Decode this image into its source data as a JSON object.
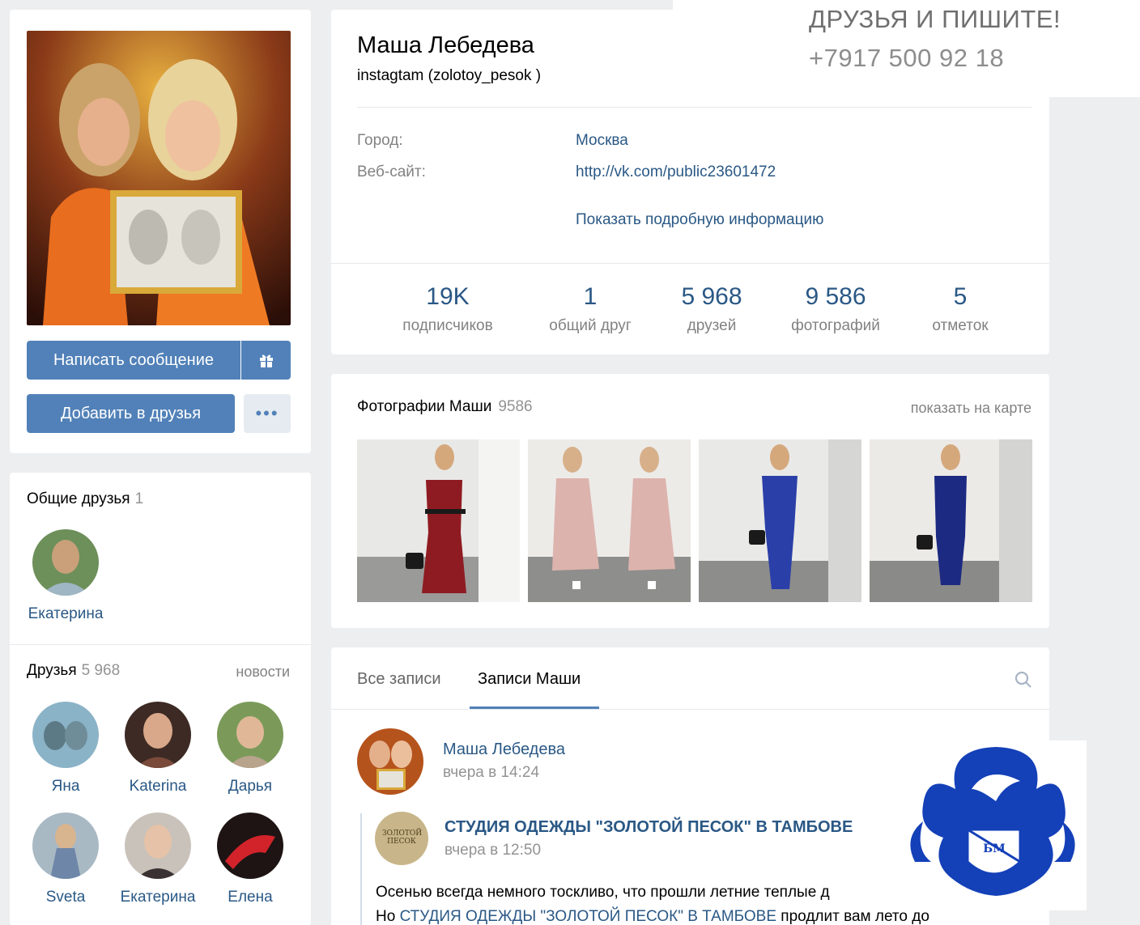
{
  "profile": {
    "name": "Маша Лебедева",
    "status": "instagtam (zolotoy_pesok )",
    "buttons": {
      "message": "Написать сообщение",
      "add_friend": "Добавить в друзья",
      "more": "•••"
    },
    "info": [
      {
        "label": "Город:",
        "value": "Москва"
      },
      {
        "label": "Веб-сайт:",
        "value": "http://vk.com/public23601472"
      }
    ],
    "show_more": "Показать подробную информацию",
    "stats": [
      {
        "num": "19K",
        "label": "подписчиков"
      },
      {
        "num": "1",
        "label": "общий друг"
      },
      {
        "num": "5 968",
        "label": "друзей"
      },
      {
        "num": "9 586",
        "label": "фотографий"
      },
      {
        "num": "5",
        "label": "отметок"
      }
    ]
  },
  "mutual": {
    "title": "Общие друзья",
    "count": "1",
    "friends": [
      {
        "name": "Екатерина"
      }
    ]
  },
  "friends": {
    "title": "Друзья",
    "count": "5 968",
    "news_link": "новости",
    "items": [
      {
        "name": "Яна"
      },
      {
        "name": "Katerina"
      },
      {
        "name": "Дарья"
      },
      {
        "name": "Sveta"
      },
      {
        "name": "Екатерина"
      },
      {
        "name": "Елена"
      }
    ]
  },
  "photos": {
    "title": "Фотографии Маши",
    "count": "9586",
    "map_link": "показать на карте"
  },
  "wall": {
    "tabs": [
      {
        "label": "Все записи"
      },
      {
        "label": "Записи Маши"
      }
    ],
    "post": {
      "author": "Маша Лебедева",
      "time": "вчера в 14:24",
      "repost_author": "СТУДИЯ ОДЕЖДЫ \"ЗОЛОТОЙ ПЕСОК\" В ТАМБОВЕ",
      "repost_time": "вчера в 12:50",
      "repost_logo_text": "ЗОЛОТОЙ ПЕСОК",
      "text_line1": "Осенью всегда немного тоскливо, что прошли летние теплые д",
      "text_line2_prefix": "Но ",
      "text_line2_link": "СТУДИЯ ОДЕЖДЫ \"ЗОЛОТОЙ ПЕСОК\" В ТАМБОВЕ",
      "text_line2_suffix": " продлит вам лето до"
    }
  },
  "overlay": {
    "line1": "ДРУЗЬЯ И ПИШИТЕ!",
    "line2": "+7917 500 92 18"
  },
  "logo_letters": "БМ"
}
